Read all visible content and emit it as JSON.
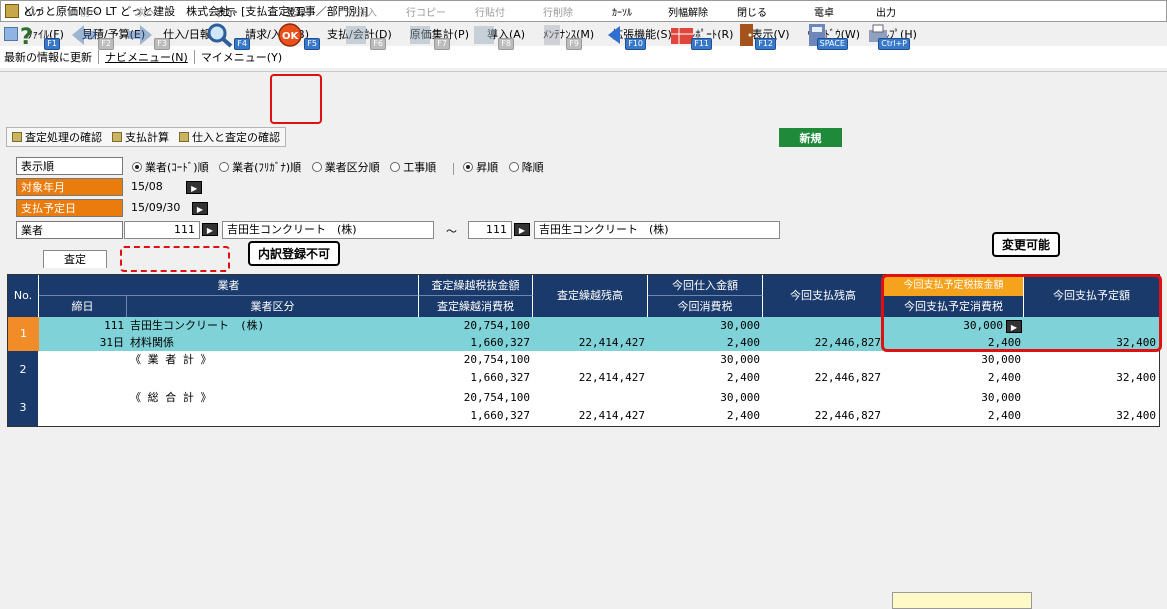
{
  "app": {
    "title": "どっと原価NEO LT どっと建設　株式会社 - [支払査定(工事／部門別)]"
  },
  "menu": [
    "ﾌｧｲﾙ(F)",
    "見積/予算(E)",
    "仕入/日報(C)",
    "請求/入金(B)",
    "支払/会計(D)",
    "原価集計(P)",
    "導入(A)",
    "ﾒﾝﾃﾅﾝｽ(M)",
    "拡張機能(S)",
    "ﾚﾎﾟｰﾄ(R)",
    "表示(V)",
    "ｳｨﾝﾄﾞｳ(W)",
    "ﾍﾙﾌﾟ(H)"
  ],
  "subbar": [
    "最新の情報に更新",
    "ナビメニュー(N)",
    "マイメニュー(Y)"
  ],
  "toolbar": [
    {
      "label": "ﾍﾙﾌﾟ",
      "key": "F1",
      "icon": "help-icon",
      "enabled": true
    },
    {
      "label": "前へ",
      "key": "F2",
      "icon": "arrow-left-icon",
      "enabled": false
    },
    {
      "label": "次へ",
      "key": "F3",
      "icon": "arrow-right-icon",
      "enabled": false
    },
    {
      "label": "表示",
      "key": "F4",
      "icon": "magnifier-icon",
      "enabled": true
    },
    {
      "label": "登録",
      "key": "F5",
      "icon": "ok-icon",
      "enabled": true
    },
    {
      "label": "行挿入",
      "key": "F6",
      "icon": "row-insert-icon",
      "enabled": false
    },
    {
      "label": "行コピー",
      "key": "F7",
      "icon": "row-copy-icon",
      "enabled": false
    },
    {
      "label": "行貼付",
      "key": "F8",
      "icon": "row-paste-icon",
      "enabled": false
    },
    {
      "label": "行削除",
      "key": "F9",
      "icon": "row-delete-icon",
      "enabled": false
    },
    {
      "label": "ｶｰｿﾙ",
      "key": "F10",
      "icon": "cursor-icon",
      "enabled": true
    },
    {
      "label": "列幅解除",
      "key": "F11",
      "icon": "column-width-icon",
      "enabled": true
    },
    {
      "label": "閉じる",
      "key": "F12",
      "icon": "close-door-icon",
      "enabled": true
    },
    {
      "label": "電卓",
      "key": "SPACE",
      "icon": "calculator-icon",
      "enabled": true
    },
    {
      "label": "出力",
      "key": "Ctrl+P",
      "icon": "output-icon",
      "enabled": true
    }
  ],
  "links": [
    "査定処理の確認",
    "支払計算",
    "仕入と査定の確認"
  ],
  "new_label": "新規",
  "form": {
    "order_label": "表示順",
    "order_options": [
      "業者(ｺｰﾄﾞ)順",
      "業者(ﾌﾘｶﾞﾅ)順",
      "業者区分順",
      "工事順"
    ],
    "dir_options": [
      "昇順",
      "降順"
    ],
    "ym_label": "対象年月",
    "ym_value": "15/08",
    "date_label": "支払予定日",
    "date_value": "15/09/30",
    "vendor_label": "業者",
    "vendor_from_code": "111",
    "vendor_from_name": "吉田生コンクリート　(株)",
    "tilde": "～",
    "vendor_to_code": "111",
    "vendor_to_name": "吉田生コンクリート　(株)"
  },
  "tab": "査定",
  "callouts": {
    "no_detail": "内訳登録不可",
    "editable": "変更可能"
  },
  "headers": {
    "no": "No.",
    "vendor": "業者",
    "close": "締日",
    "vendor_cat": "業者区分",
    "c1a": "査定繰越税抜金額",
    "c1b": "査定繰越消費税",
    "c2": "査定繰越残高",
    "c3a": "今回仕入金額",
    "c3b": "今回消費税",
    "c4": "今回支払残高",
    "c5a": "今回支払予定税抜金額",
    "c5b": "今回支払予定消費税",
    "c6": "今回支払予定額"
  },
  "rows": [
    {
      "no": "1",
      "code": "111",
      "name": "吉田生コンクリート　(株)",
      "close": "31日",
      "cat": "材料関係",
      "c1a": "20,754,100",
      "c1b": "1,660,327",
      "c2": "22,414,427",
      "c3a": "30,000",
      "c3b": "2,400",
      "c4": "22,446,827",
      "c5a": "30,000",
      "c5b": "2,400",
      "c6": "32,400"
    },
    {
      "no": "2",
      "code": "",
      "name": "《 業 者 計 》",
      "close": "",
      "cat": "",
      "c1a": "20,754,100",
      "c1b": "1,660,327",
      "c2": "22,414,427",
      "c3a": "30,000",
      "c3b": "2,400",
      "c4": "22,446,827",
      "c5a": "30,000",
      "c5b": "2,400",
      "c6": "32,400"
    },
    {
      "no": "3",
      "code": "",
      "name": "《 総 合 計 》",
      "close": "",
      "cat": "",
      "c1a": "20,754,100",
      "c1b": "1,660,327",
      "c2": "22,414,427",
      "c3a": "30,000",
      "c3b": "2,400",
      "c4": "22,446,827",
      "c5a": "30,000",
      "c5b": "2,400",
      "c6": "32,400"
    }
  ],
  "colors": {
    "header": "#1a3a6b",
    "row_selected": "#7fd3d8",
    "row_total": "#1a3a6b",
    "no_selected": "#f28c28",
    "highlight_header": "#f5a21c",
    "accent": "#e01010"
  }
}
